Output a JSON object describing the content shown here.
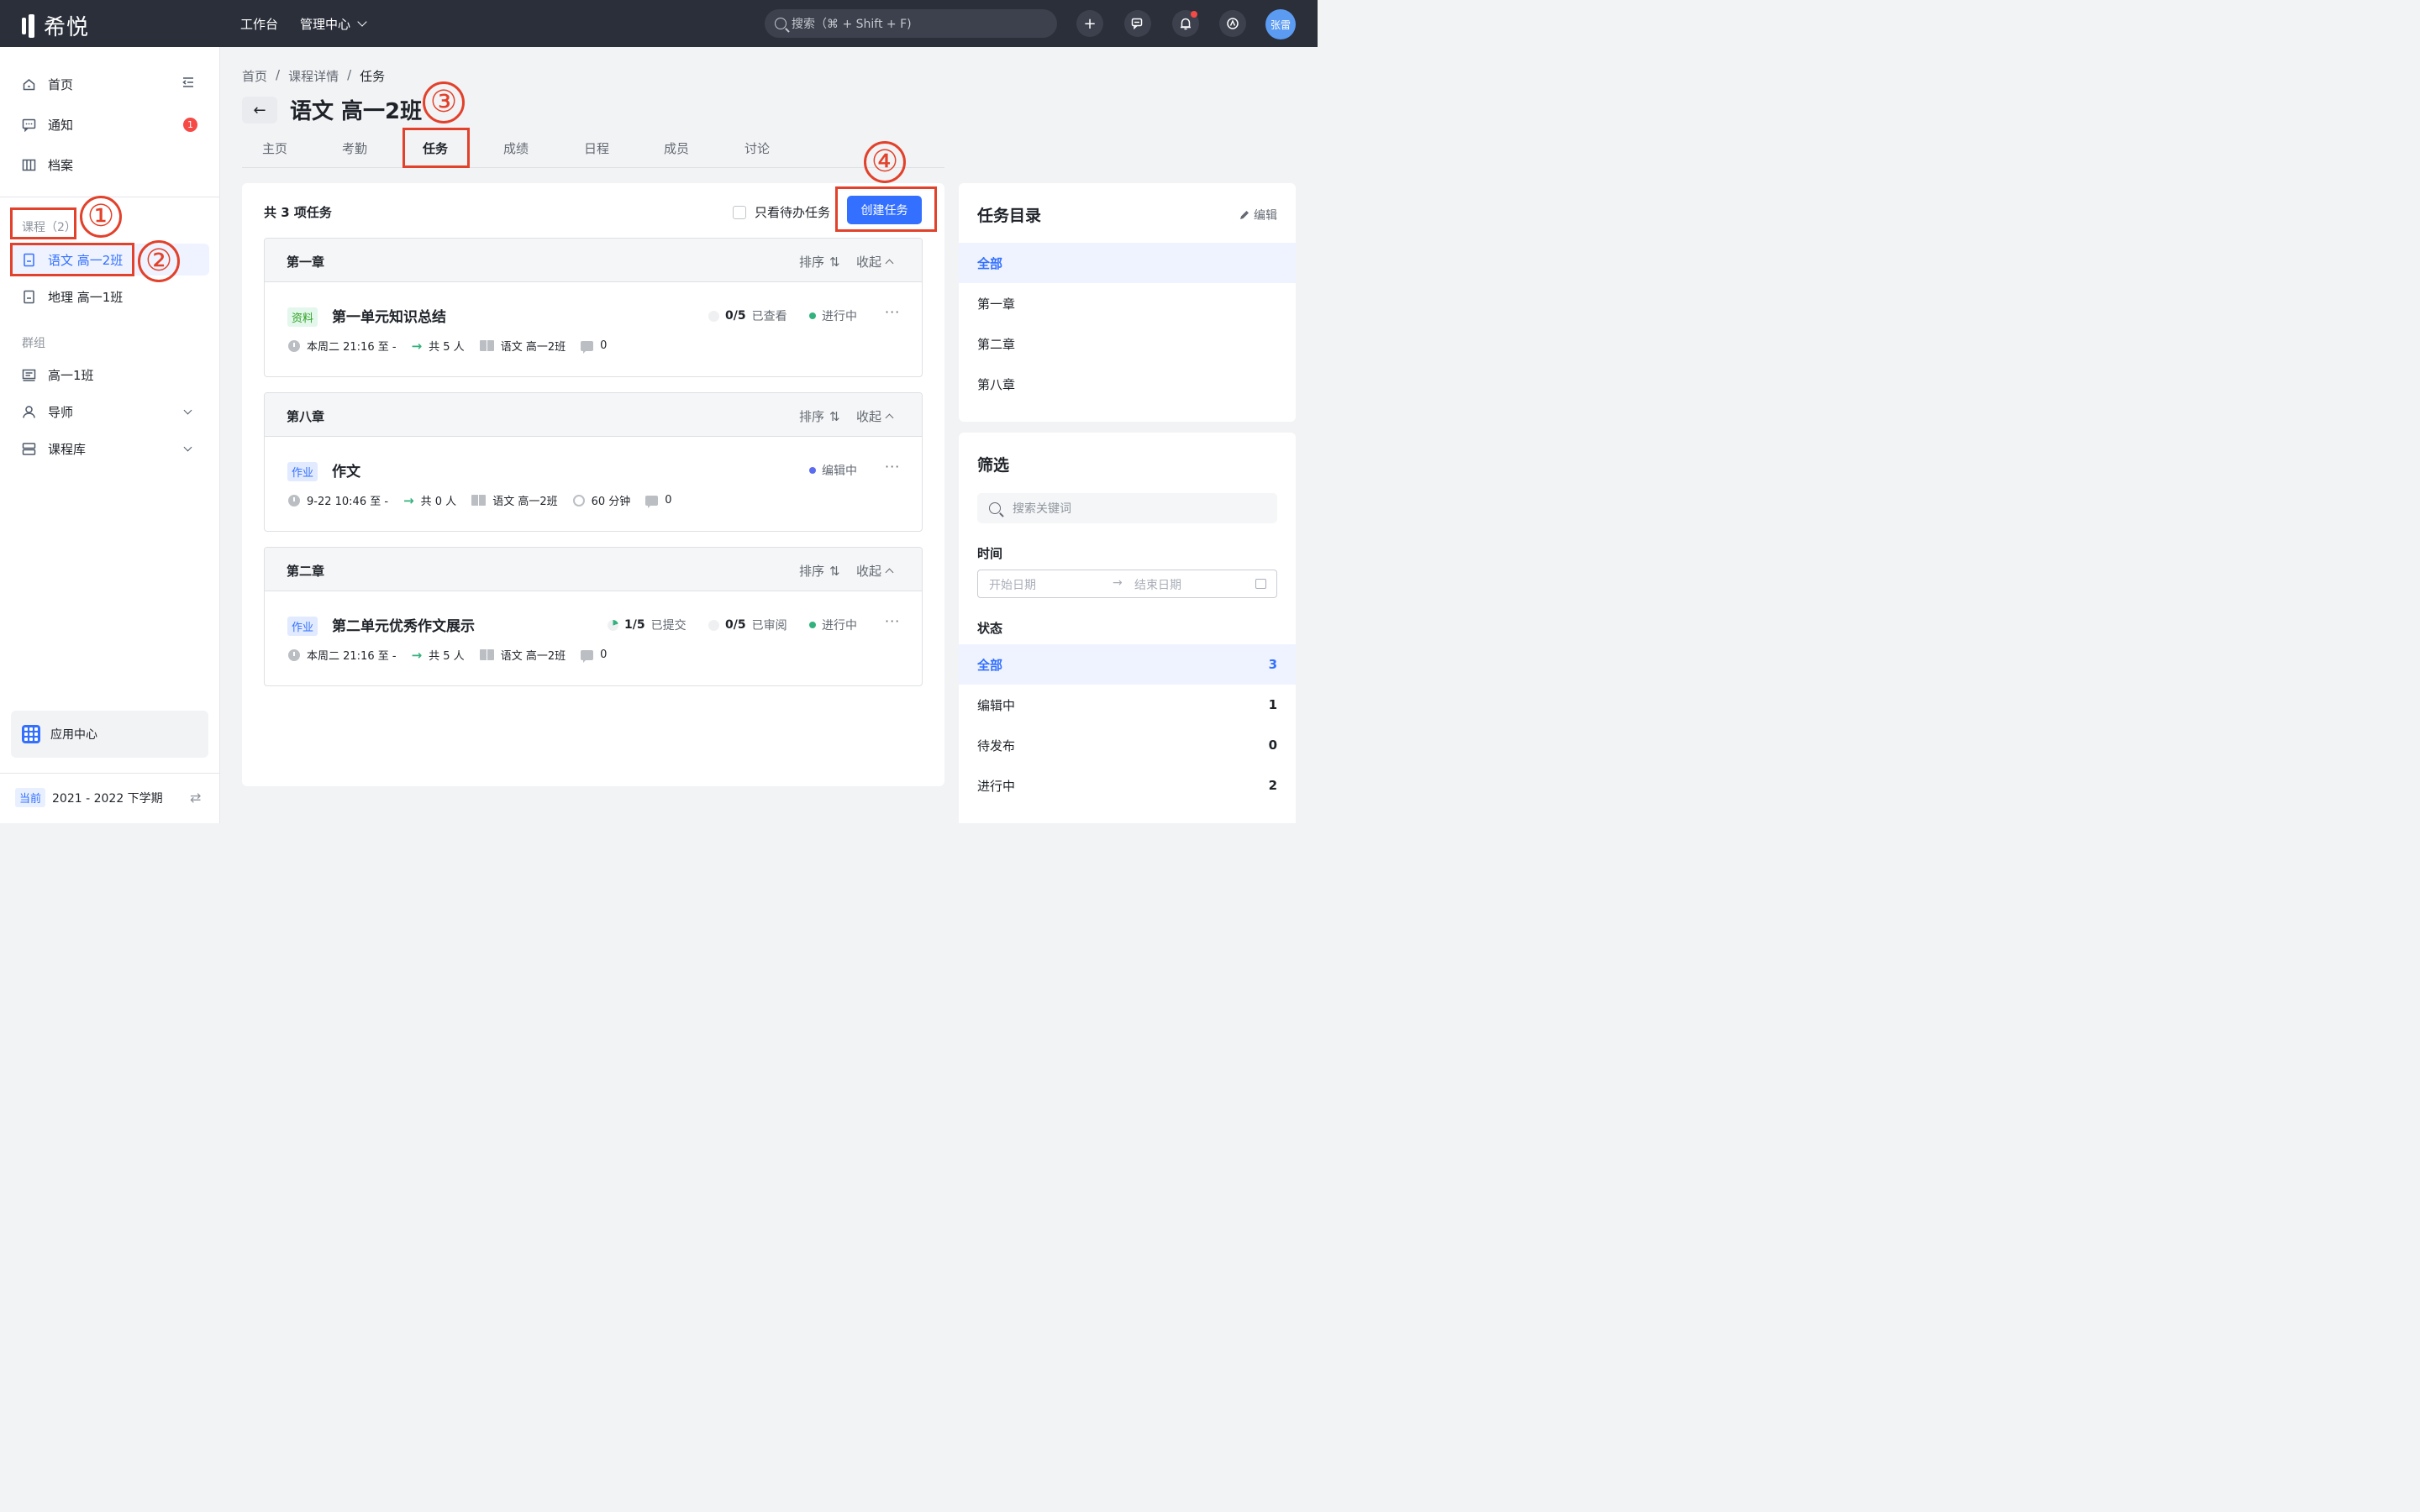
{
  "topbar": {
    "logo_text": "希悦",
    "nav": [
      {
        "label": "工作台"
      },
      {
        "label": "管理中心"
      }
    ],
    "search_placeholder": "搜索（⌘ + Shift + F)",
    "avatar_text": "张雷"
  },
  "sidebar": {
    "main_items": [
      {
        "label": "首页"
      },
      {
        "label": "通知",
        "badge": "1"
      },
      {
        "label": "档案"
      }
    ],
    "courses_label": "课程（2）",
    "courses": [
      {
        "label": "语文 高一2班"
      },
      {
        "label": "地理 高一1班"
      }
    ],
    "groups_label": "群组",
    "groups": [
      {
        "label": "高一1班"
      },
      {
        "label": "导师"
      },
      {
        "label": "课程库"
      }
    ],
    "app_center": "应用中心",
    "term_tag": "当前",
    "term_label": "2021 - 2022 下学期"
  },
  "annotations": [
    "①",
    "②",
    "③",
    "④"
  ],
  "page": {
    "breadcrumb": [
      "首页",
      "课程详情",
      "任务"
    ],
    "title": "语文 高一2班",
    "tabs": [
      "主页",
      "考勤",
      "任务",
      "成绩",
      "日程",
      "成员",
      "讨论"
    ],
    "active_tab": "任务"
  },
  "tasks_panel": {
    "count_label": "共 3 项任务",
    "only_todo_label": "只看待办任务",
    "create_button": "创建任务",
    "sort_label": "排序",
    "collapse_label": "收起",
    "chapters": [
      {
        "title": "第一章",
        "task": {
          "tag": "资料",
          "name": "第一单元知识总结",
          "time": "本周二 21:16 至 -",
          "people": "共 5 人",
          "course": "语文 高一2班",
          "comments": "0",
          "stats": [
            {
              "value": "0",
              "total": "/5",
              "label": "已查看"
            }
          ],
          "status": "进行中",
          "status_color": "#34b27d"
        }
      },
      {
        "title": "第八章",
        "task": {
          "tag": "作业",
          "name": "作文",
          "time": "9-22 10:46 至 -",
          "people": "共 0 人",
          "course": "语文 高一2班",
          "duration": "60 分钟",
          "comments": "0",
          "status": "编辑中",
          "status_color": "#5b6cf0"
        }
      },
      {
        "title": "第二章",
        "task": {
          "tag": "作业",
          "name": "第二单元优秀作文展示",
          "time": "本周二 21:16 至 -",
          "people": "共 5 人",
          "course": "语文 高一2班",
          "comments": "0",
          "stats": [
            {
              "value": "1",
              "total": "/5",
              "label": "已提交"
            },
            {
              "value": "0",
              "total": "/5",
              "label": "已审阅"
            }
          ],
          "status": "进行中",
          "status_color": "#34b27d"
        }
      }
    ]
  },
  "catalog": {
    "title": "任务目录",
    "edit_label": "编辑",
    "items": [
      "全部",
      "第一章",
      "第二章",
      "第八章"
    ]
  },
  "filter": {
    "title": "筛选",
    "keyword_placeholder": "搜索关键词",
    "time_label": "时间",
    "start_placeholder": "开始日期",
    "end_placeholder": "结束日期",
    "status_label": "状态",
    "statuses": [
      {
        "label": "全部",
        "count": "3"
      },
      {
        "label": "编辑中",
        "count": "1"
      },
      {
        "label": "待发布",
        "count": "0"
      },
      {
        "label": "进行中",
        "count": "2"
      }
    ]
  }
}
